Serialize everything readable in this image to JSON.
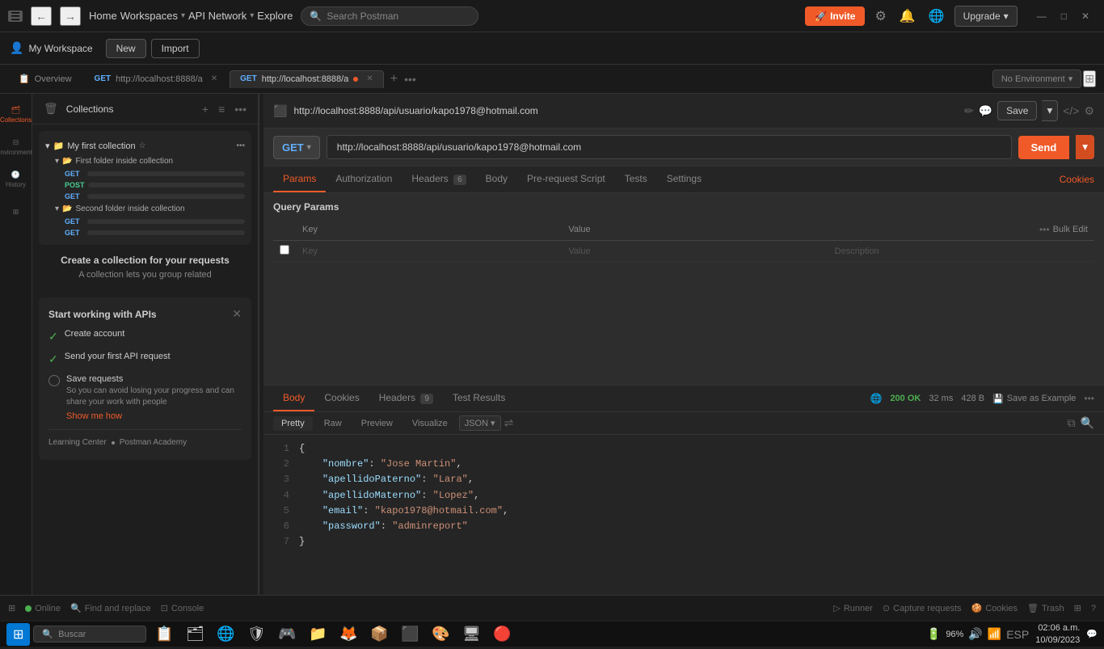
{
  "titlebar": {
    "menu_icon": "☰",
    "back_icon": "←",
    "forward_icon": "→",
    "nav_items": [
      "Home",
      "Workspaces",
      "API Network",
      "Explore"
    ],
    "search_placeholder": "Search Postman",
    "invite_label": "Invite",
    "upgrade_label": "Upgrade",
    "minimize": "—",
    "maximize": "□",
    "close": "✕"
  },
  "workspace": {
    "icon": "👤",
    "label": "My Workspace",
    "new_label": "New",
    "import_label": "Import"
  },
  "tabs": [
    {
      "id": "overview",
      "label": "Overview",
      "type": "overview"
    },
    {
      "id": "tab1",
      "method": "GET",
      "url": "http://localhost:8888/a",
      "active": false,
      "has_dot": false
    },
    {
      "id": "tab2",
      "method": "GET",
      "url": "http://localhost:8888/a",
      "active": true,
      "has_dot": true
    }
  ],
  "no_env": "No Environment",
  "sidebar": {
    "collections_label": "Collections",
    "history_label": "History",
    "environments_label": "Environments"
  },
  "collection": {
    "name": "My first collection",
    "folders": [
      {
        "name": "First folder inside collection",
        "requests": [
          {
            "method": "GET"
          },
          {
            "method": "POST"
          },
          {
            "method": "GET"
          }
        ]
      },
      {
        "name": "Second folder inside collection",
        "requests": [
          {
            "method": "GET"
          },
          {
            "method": "GET"
          }
        ]
      }
    ]
  },
  "create_collection": {
    "title": "Create a collection for your requests",
    "desc": "A collection lets you group related"
  },
  "start_panel": {
    "title": "Start working with APIs",
    "items": [
      {
        "label": "Create account",
        "done": true
      },
      {
        "label": "Send your first API request",
        "done": true
      },
      {
        "label": "Save requests",
        "done": false,
        "desc": "So you can avoid losing your progress and can share your work with people",
        "link": "Show me how"
      }
    ],
    "links": [
      {
        "label": "Learning Center"
      },
      {
        "label": "Postman Academy"
      }
    ]
  },
  "request": {
    "icon": "🔲",
    "url_display": "http://localhost:8888/api/usuario/kapo1978@hotmail.com",
    "save_label": "Save",
    "method": "GET",
    "url": "http://localhost:8888/api/usuario/kapo1978@hotmail.com",
    "send_label": "Send"
  },
  "req_tabs": {
    "tabs": [
      {
        "id": "params",
        "label": "Params",
        "active": true
      },
      {
        "id": "authorization",
        "label": "Authorization",
        "active": false
      },
      {
        "id": "headers",
        "label": "Headers",
        "badge": "6",
        "active": false
      },
      {
        "id": "body",
        "label": "Body",
        "active": false
      },
      {
        "id": "pre_request",
        "label": "Pre-request Script",
        "active": false
      },
      {
        "id": "tests",
        "label": "Tests",
        "active": false
      },
      {
        "id": "settings",
        "label": "Settings",
        "active": false
      }
    ],
    "cookies_label": "Cookies"
  },
  "query_params": {
    "title": "Query Params",
    "columns": [
      "Key",
      "Value",
      "Description"
    ],
    "bulk_edit_label": "Bulk Edit",
    "rows": [
      {
        "key": "Key",
        "value": "Value",
        "desc": "Description"
      }
    ]
  },
  "response": {
    "tabs": [
      {
        "id": "body",
        "label": "Body",
        "active": true
      },
      {
        "id": "cookies",
        "label": "Cookies",
        "active": false
      },
      {
        "id": "headers",
        "label": "Headers",
        "badge": "9",
        "active": false
      },
      {
        "id": "test_results",
        "label": "Test Results",
        "active": false
      }
    ],
    "status": "200 OK",
    "time": "32 ms",
    "size": "428 B",
    "save_example": "Save as Example",
    "format_tabs": [
      "Pretty",
      "Raw",
      "Preview",
      "Visualize"
    ],
    "active_format": "Pretty",
    "format": "JSON",
    "json_lines": [
      {
        "num": "1",
        "content": "{",
        "type": "brace"
      },
      {
        "num": "2",
        "key": "\"nombre\"",
        "value": "\"Jose Martin\""
      },
      {
        "num": "3",
        "key": "\"apellidoPaterno\"",
        "value": "\"Lara\""
      },
      {
        "num": "4",
        "key": "\"apellidoMaterno\"",
        "value": "\"Lopez\""
      },
      {
        "num": "5",
        "key": "\"email\"",
        "value": "\"kapo1978@hotmail.com\""
      },
      {
        "num": "6",
        "key": "\"password\"",
        "value": "\"adminreport\""
      },
      {
        "num": "7",
        "content": "}",
        "type": "brace"
      }
    ]
  },
  "statusbar": {
    "online": "Online",
    "find_replace": "Find and replace",
    "console": "Console",
    "runner": "Runner",
    "capture": "Capture requests",
    "cookies": "Cookies",
    "trash": "Trash"
  },
  "taskbar": {
    "search_placeholder": "Buscar",
    "time": "02:06 a.m.",
    "date": "10/09/2023",
    "battery": "96%",
    "language": "ESP"
  }
}
